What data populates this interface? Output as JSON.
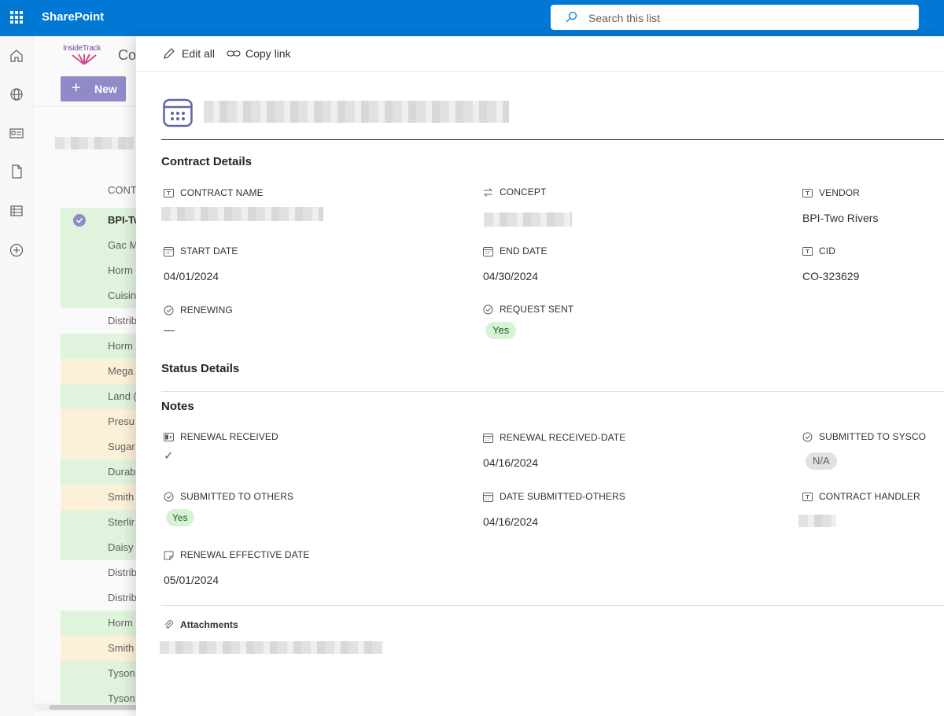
{
  "suite": {
    "app_name": "SharePoint",
    "search_placeholder": "Search this list"
  },
  "colors": {
    "suite_bar": "#0078d4",
    "accent": "#8f8bc7",
    "row_green": "#dff3dd",
    "row_orange": "#fdf0d8",
    "pill_yes": "#d8f3d4"
  },
  "rail": {
    "icons": [
      "home-icon",
      "globe-icon",
      "news-icon",
      "document-icon",
      "list-icon",
      "add-circle-icon"
    ]
  },
  "list": {
    "logo_text": "InsideTrack",
    "site_title_partial": "Co",
    "new_button": "New",
    "column_header_partial": "CONT",
    "rows": [
      {
        "text": "BPI-Tw",
        "color": "green",
        "selected": true
      },
      {
        "text": "Gac M",
        "color": "green"
      },
      {
        "text": "Horm",
        "color": "green"
      },
      {
        "text": "Cuisin",
        "color": "green"
      },
      {
        "text": "Distrib",
        "color": "white"
      },
      {
        "text": "Horm",
        "color": "green"
      },
      {
        "text": "Mega",
        "color": "orange"
      },
      {
        "text": "Land (",
        "color": "green"
      },
      {
        "text": "Presu",
        "color": "orange"
      },
      {
        "text": "Sugar",
        "color": "orange"
      },
      {
        "text": "Durab",
        "color": "green"
      },
      {
        "text": "Smith",
        "color": "orange"
      },
      {
        "text": "Sterlir",
        "color": "green"
      },
      {
        "text": "Daisy",
        "color": "green"
      },
      {
        "text": "Distrib",
        "color": "white"
      },
      {
        "text": "Distrib",
        "color": "white"
      },
      {
        "text": "Horm",
        "color": "green"
      },
      {
        "text": "Smith",
        "color": "orange"
      },
      {
        "text": "Tyson",
        "color": "green"
      },
      {
        "text": "Tyson",
        "color": "green"
      }
    ]
  },
  "panel": {
    "edit_all": "Edit all",
    "copy_link": "Copy link",
    "sections": {
      "contract_details": "Contract Details",
      "status_details": "Status Details",
      "notes": "Notes"
    },
    "fields": {
      "contract_name": {
        "label": "CONTRACT NAME"
      },
      "concept": {
        "label": "CONCEPT"
      },
      "vendor": {
        "label": "VENDOR",
        "value": "BPI-Two Rivers"
      },
      "start_date": {
        "label": "START DATE",
        "value": "04/01/2024"
      },
      "end_date": {
        "label": "END DATE",
        "value": "04/30/2024"
      },
      "cid": {
        "label": "CID",
        "value": "CO-323629"
      },
      "renewing": {
        "label": "RENEWING",
        "value": "—"
      },
      "request_sent": {
        "label": "REQUEST SENT",
        "value": "Yes"
      },
      "renewal_received": {
        "label": "RENEWAL RECEIVED",
        "value": "✓"
      },
      "renewal_received_date": {
        "label": "RENEWAL RECEIVED-DATE",
        "value": "04/16/2024"
      },
      "submitted_to_sysco": {
        "label": "SUBMITTED TO SYSCO",
        "value": "N/A"
      },
      "submitted_to_others": {
        "label": "SUBMITTED TO OTHERS",
        "value": "Yes"
      },
      "date_submitted_others": {
        "label": "DATE SUBMITTED-OTHERS",
        "value": "04/16/2024"
      },
      "contract_handler": {
        "label": "CONTRACT HANDLER"
      },
      "renewal_effective_date": {
        "label": "RENEWAL EFFECTIVE DATE",
        "value": "05/01/2024"
      }
    },
    "attachments_label": "Attachments"
  }
}
